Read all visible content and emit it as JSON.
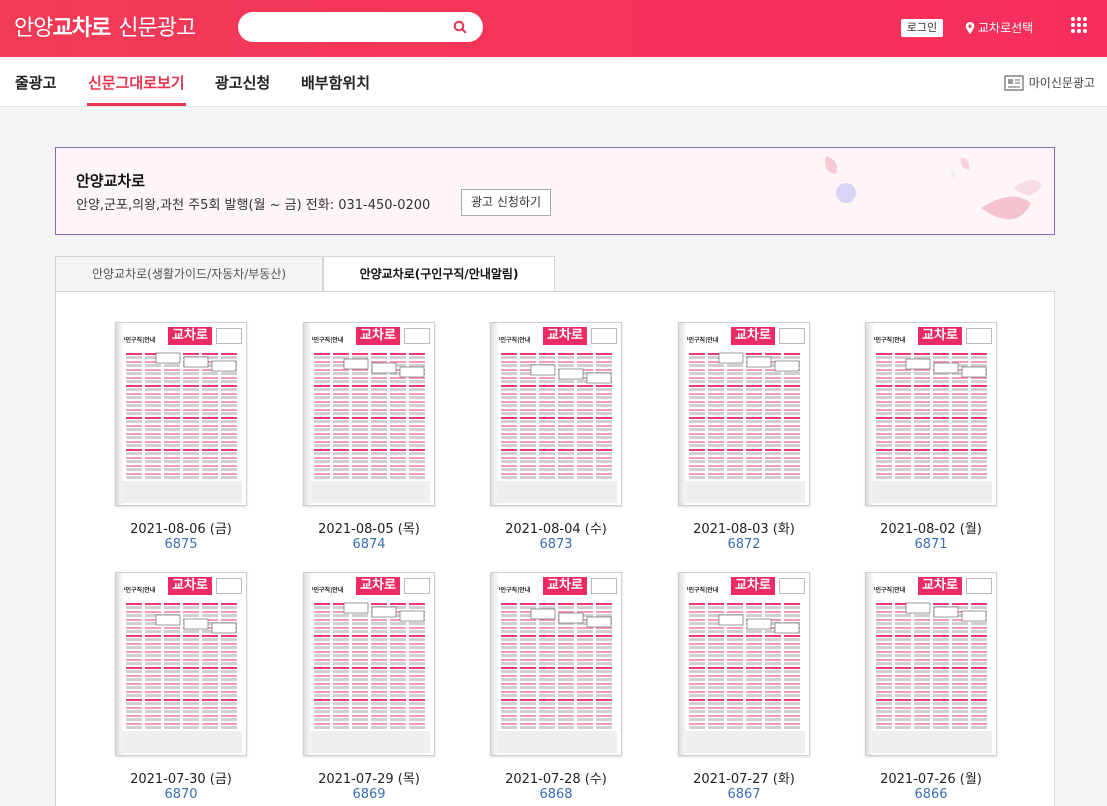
{
  "header": {
    "logo_region": "안양",
    "logo_brand": "교차로",
    "logo_suffix": "신문광고",
    "search_placeholder": "",
    "login_label": "로그인",
    "region_label": "교차로선택",
    "icons": {
      "search": "search-icon",
      "location": "location-pin-icon",
      "menu": "grid-menu-icon"
    },
    "brand_color": "#f13a56"
  },
  "nav": {
    "items": [
      "줄광고",
      "신문그대로보기",
      "광고신청",
      "배부함위치"
    ],
    "active_index": 1,
    "my_ads_label": "마이신문광고",
    "accent": "#e8344f"
  },
  "banner": {
    "title": "안양교차로",
    "description": "안양,군포,의왕,과천 주5회 발행(월 ~ 금) 전화: 031-450-0200",
    "button_label": "광고 신청하기"
  },
  "tabs": {
    "items": [
      "안양교차로(생활가이드/자동차/부동산)",
      "안양교차로(구인구직/안내알림)"
    ],
    "active_index": 1
  },
  "papers": [
    {
      "date": "2021-08-06 (금)",
      "issue": "6875",
      "cover_label": "교차로",
      "cover_section": "구인구직|안내"
    },
    {
      "date": "2021-08-05 (목)",
      "issue": "6874",
      "cover_label": "교차로",
      "cover_section": "구인구직|안내"
    },
    {
      "date": "2021-08-04 (수)",
      "issue": "6873",
      "cover_label": "교차로",
      "cover_section": "구인구직|안내"
    },
    {
      "date": "2021-08-03 (화)",
      "issue": "6872",
      "cover_label": "교차로",
      "cover_section": "구인구직|안내"
    },
    {
      "date": "2021-08-02 (월)",
      "issue": "6871",
      "cover_label": "교차로",
      "cover_section": "구인구직|안내"
    },
    {
      "date": "2021-07-30 (금)",
      "issue": "6870",
      "cover_label": "교차로",
      "cover_section": "구인구직|안내"
    },
    {
      "date": "2021-07-29 (목)",
      "issue": "6869",
      "cover_label": "교차로",
      "cover_section": "구인구직|안내"
    },
    {
      "date": "2021-07-28 (수)",
      "issue": "6868",
      "cover_label": "교차로",
      "cover_section": "구인구직|안내"
    },
    {
      "date": "2021-07-27 (화)",
      "issue": "6867",
      "cover_label": "교차로",
      "cover_section": "구인구직|안내"
    },
    {
      "date": "2021-07-26 (월)",
      "issue": "6866",
      "cover_label": "교차로",
      "cover_section": "구인구직|안내"
    }
  ]
}
